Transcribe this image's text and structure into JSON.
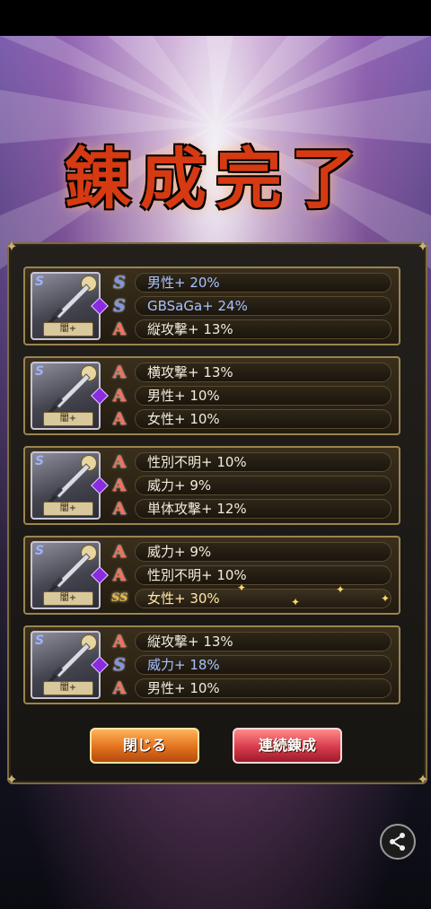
{
  "title": "錬成完了",
  "results": [
    {
      "badge": "闇+",
      "traits": [
        {
          "rank": "S",
          "label": "男性+ 20%"
        },
        {
          "rank": "S",
          "label": "GBSaGa+ 24%"
        },
        {
          "rank": "A",
          "label": "縦攻撃+ 13%"
        }
      ]
    },
    {
      "badge": "闇+",
      "traits": [
        {
          "rank": "A",
          "label": "横攻撃+ 13%"
        },
        {
          "rank": "A",
          "label": "男性+ 10%"
        },
        {
          "rank": "A",
          "label": "女性+ 10%"
        }
      ]
    },
    {
      "badge": "闇+",
      "traits": [
        {
          "rank": "A",
          "label": "性別不明+ 10%"
        },
        {
          "rank": "A",
          "label": "威力+ 9%"
        },
        {
          "rank": "A",
          "label": "単体攻撃+ 12%"
        }
      ]
    },
    {
      "badge": "闇+",
      "traits": [
        {
          "rank": "A",
          "label": "威力+ 9%"
        },
        {
          "rank": "A",
          "label": "性別不明+ 10%"
        },
        {
          "rank": "SS",
          "label": "女性+ 30%"
        }
      ]
    },
    {
      "badge": "闇+",
      "traits": [
        {
          "rank": "A",
          "label": "縦攻撃+ 13%"
        },
        {
          "rank": "S",
          "label": "威力+ 18%"
        },
        {
          "rank": "A",
          "label": "男性+ 10%"
        }
      ]
    }
  ],
  "buttons": {
    "close": "閉じる",
    "continue": "連続錬成"
  },
  "rank_glyphs": {
    "A": "A",
    "S": "S",
    "SS": "SS"
  },
  "icons": {
    "share": "share-icon",
    "sword": "sword-icon",
    "gem": "gem-icon"
  }
}
